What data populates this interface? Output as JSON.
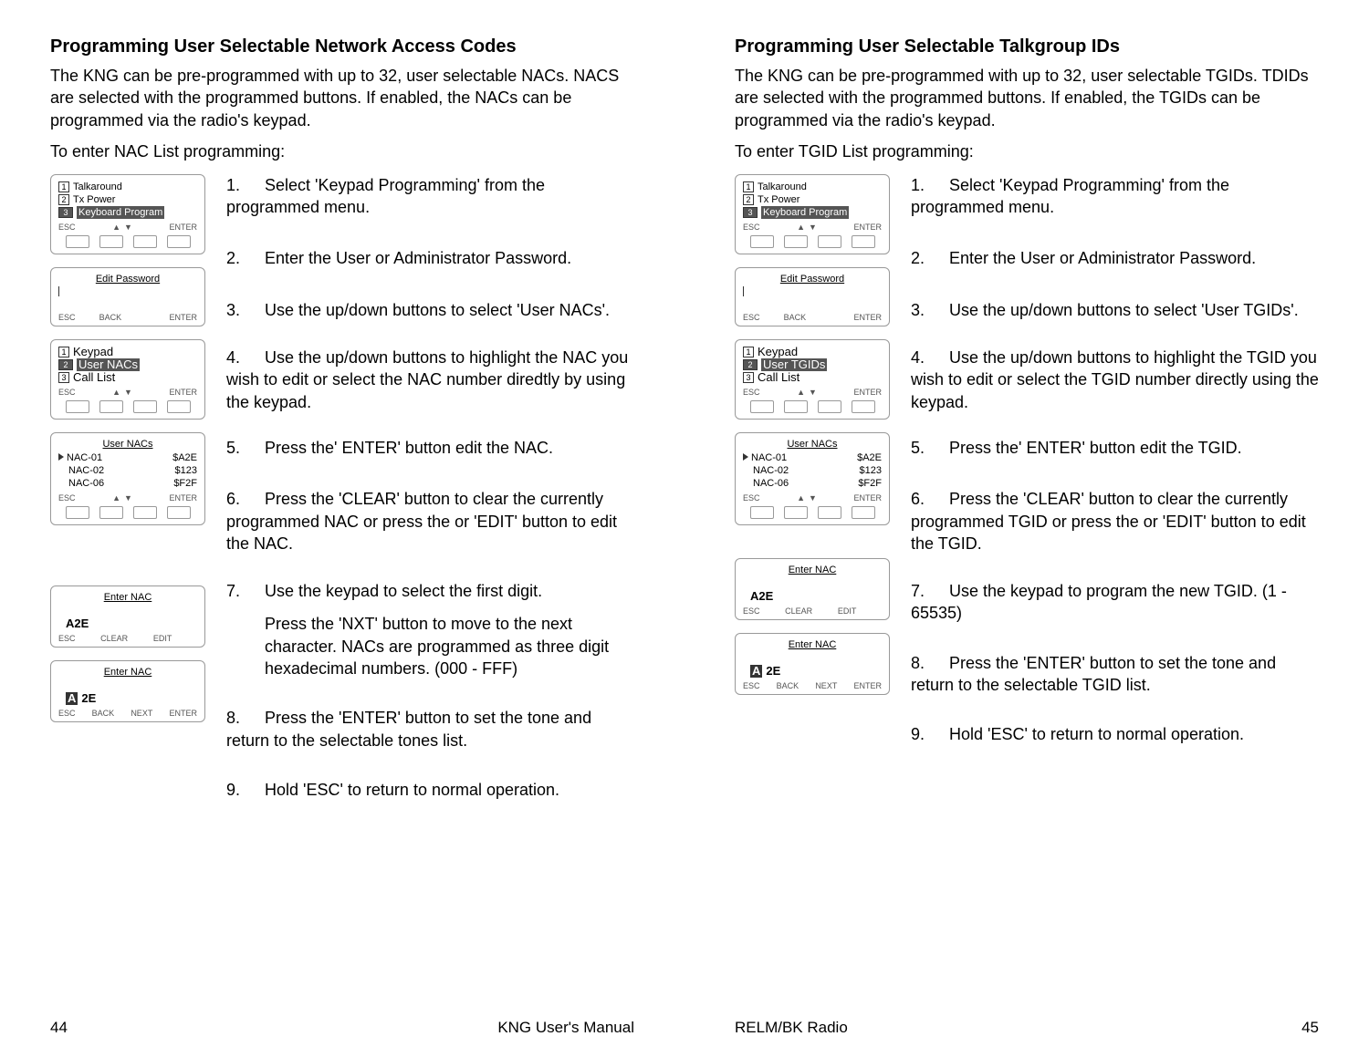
{
  "leftPage": {
    "title": "Programming User Selectable Network Access Codes",
    "intro": "The KNG can be pre-programmed with up to 32, user selectable NACs. NACS are selected with the programmed buttons. If enabled, the NACs can be programmed via the radio's keypad.",
    "sub": "To enter NAC List programming:",
    "steps": {
      "s1": "Select 'Keypad Programming' from the programmed menu.",
      "s2": "Enter the User or Administrator Password.",
      "s3": "Use the up/down buttons to select 'User NACs'.",
      "s4": "Use the up/down buttons to highlight the NAC you wish to edit or select the NAC number diredtly by using the keypad.",
      "s5": "Press the' ENTER' button edit the NAC.",
      "s6": "Press the 'CLEAR' button to clear the currently programmed NAC or press the or 'EDIT' button to edit the NAC.",
      "s7a": "Use the keypad to select the first digit.",
      "s7b": "Press the 'NXT' button to move to the next character. NACs are programmed as three digit hexadecimal numbers. (000 - FFF)",
      "s8": "Press the 'ENTER' button to set the tone and return to the selectable tones list.",
      "s9": "Hold 'ESC' to return to normal operation."
    },
    "screens": {
      "menu1": {
        "i1": "Talkaround",
        "i2": "Tx Power",
        "i3": "Keyboard Program",
        "k1": "ESC",
        "k4": "ENTER"
      },
      "pwd": {
        "title": "Edit Password",
        "k1": "ESC",
        "k2": "BACK",
        "k4": "ENTER"
      },
      "menu2": {
        "i1": "Keypad",
        "i2": "User NACs",
        "i3": "Call List",
        "k1": "ESC",
        "k4": "ENTER"
      },
      "list": {
        "title": "User NACs",
        "r1a": "NAC-01",
        "r1b": "$A2E",
        "r2a": "NAC-02",
        "r2b": "$123",
        "r3a": "NAC-06",
        "r3b": "$F2F",
        "k1": "ESC",
        "k4": "ENTER"
      },
      "enter1": {
        "title": "Enter NAC",
        "val": "A2E",
        "k1": "ESC",
        "k2": "CLEAR",
        "k3": "EDIT"
      },
      "enter2": {
        "title": "Enter NAC",
        "valA": "A",
        "valB": "2E",
        "k1": "ESC",
        "k2": "BACK",
        "k3": "NEXT",
        "k4": "ENTER"
      }
    },
    "footer": {
      "num": "44",
      "label": "KNG User's Manual"
    }
  },
  "rightPage": {
    "title": "Programming User Selectable Talkgroup IDs",
    "intro": "The KNG can be pre-programmed with up to 32, user selectable TGIDs. TDIDs are selected with the programmed buttons. If enabled, the TGIDs can be programmed via the radio's keypad.",
    "sub": "To enter TGID List programming:",
    "steps": {
      "s1": "Select 'Keypad Programming' from the programmed menu.",
      "s2": "Enter the User or Administrator Password.",
      "s3": "Use the up/down buttons to select 'User TGIDs'.",
      "s4": "Use the up/down buttons to highlight the TGID you wish to edit or select the TGID number directly using the keypad.",
      "s5": "Press the' ENTER' button edit the TGID.",
      "s6": "Press the 'CLEAR' button to clear the currently programmed TGID or press the or 'EDIT' button to edit the TGID.",
      "s7": "Use the keypad to program the new TGID. (1 - 65535)",
      "s8": "Press the 'ENTER' button to set the tone and return to the selectable TGID list.",
      "s9": "Hold 'ESC' to return to normal operation."
    },
    "screens": {
      "menu1": {
        "i1": "Talkaround",
        "i2": "Tx Power",
        "i3": "Keyboard Program",
        "k1": "ESC",
        "k4": "ENTER"
      },
      "pwd": {
        "title": "Edit Password",
        "k1": "ESC",
        "k2": "BACK",
        "k4": "ENTER"
      },
      "menu2": {
        "i1": "Keypad",
        "i2": "User TGIDs",
        "i3": "Call List",
        "k1": "ESC",
        "k4": "ENTER"
      },
      "list": {
        "title": "User NACs",
        "r1a": "NAC-01",
        "r1b": "$A2E",
        "r2a": "NAC-02",
        "r2b": "$123",
        "r3a": "NAC-06",
        "r3b": "$F2F",
        "k1": "ESC",
        "k4": "ENTER"
      },
      "enter1": {
        "title": "Enter NAC",
        "val": "A2E",
        "k1": "ESC",
        "k2": "CLEAR",
        "k3": "EDIT"
      },
      "enter2": {
        "title": "Enter NAC",
        "valA": "A",
        "valB": "2E",
        "k1": "ESC",
        "k2": "BACK",
        "k3": "NEXT",
        "k4": "ENTER"
      }
    },
    "footer": {
      "num": "45",
      "label": "RELM/BK Radio"
    }
  }
}
